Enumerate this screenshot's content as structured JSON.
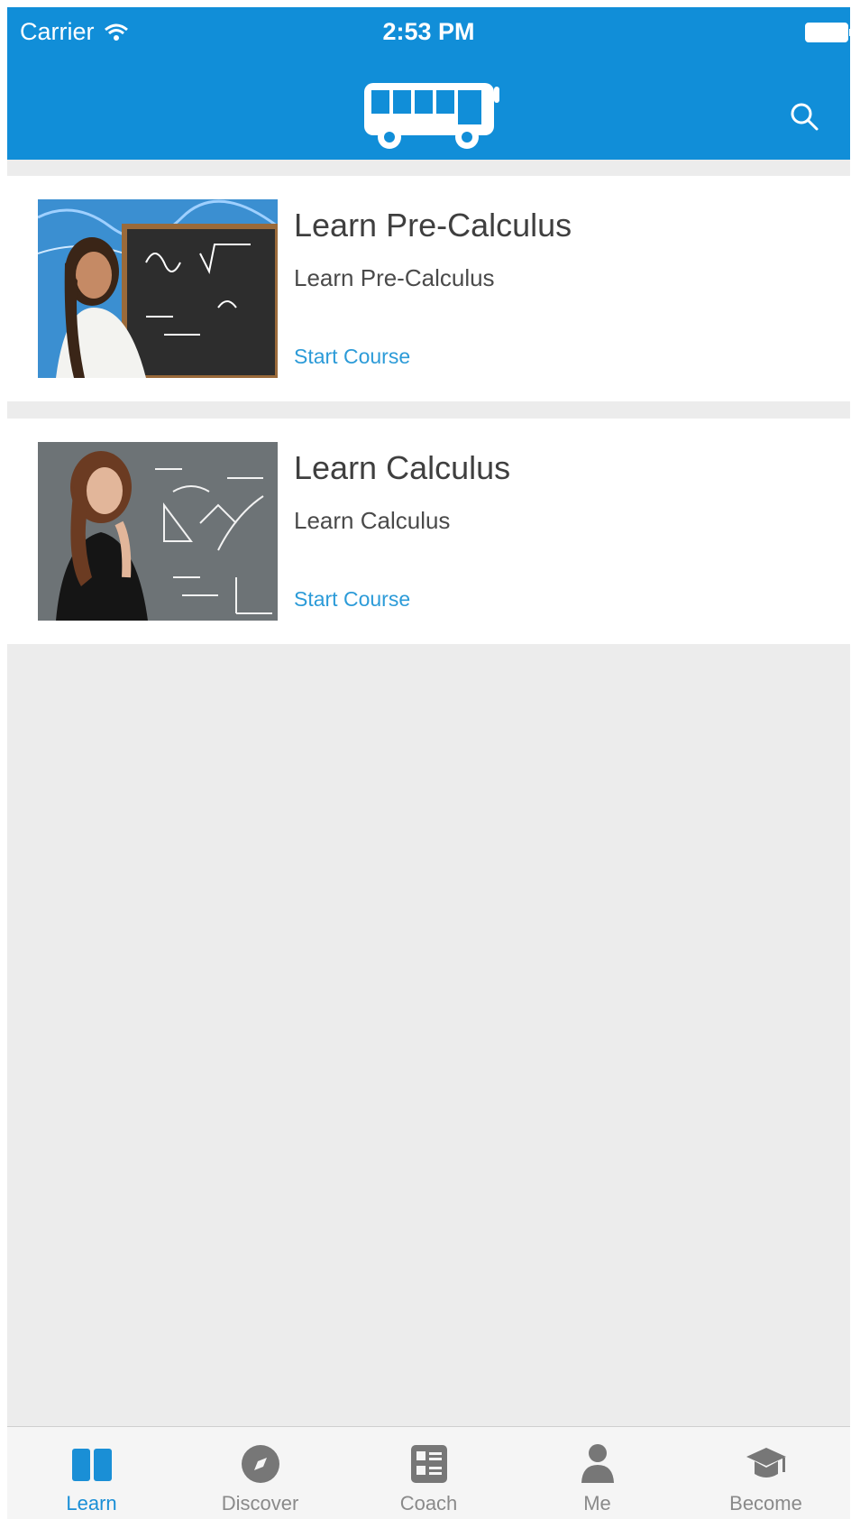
{
  "status_bar": {
    "carrier": "Carrier",
    "time": "2:53 PM"
  },
  "nav": {
    "logo_icon": "bus-icon",
    "search_icon": "search-icon"
  },
  "courses": [
    {
      "title": "Learn Pre-Calculus",
      "subtitle": "Learn Pre-Calculus",
      "action": "Start Course",
      "thumbnail": "woman-at-chalkboard"
    },
    {
      "title": "Learn Calculus",
      "subtitle": "Learn Calculus",
      "action": "Start Course",
      "thumbnail": "woman-at-formula-board"
    }
  ],
  "tabbar": {
    "tabs": [
      {
        "label": "Learn",
        "icon": "book-icon",
        "active": true
      },
      {
        "label": "Discover",
        "icon": "compass-icon",
        "active": false
      },
      {
        "label": "Coach",
        "icon": "coach-icon",
        "active": false
      },
      {
        "label": "Me",
        "icon": "person-icon",
        "active": false
      },
      {
        "label": "Become",
        "icon": "graduation-cap-icon",
        "active": false
      }
    ]
  },
  "colors": {
    "brand_blue": "#118ed8",
    "link_blue": "#2c9bd8",
    "background_gray": "#ececec",
    "tab_inactive": "#8a8a8a"
  }
}
